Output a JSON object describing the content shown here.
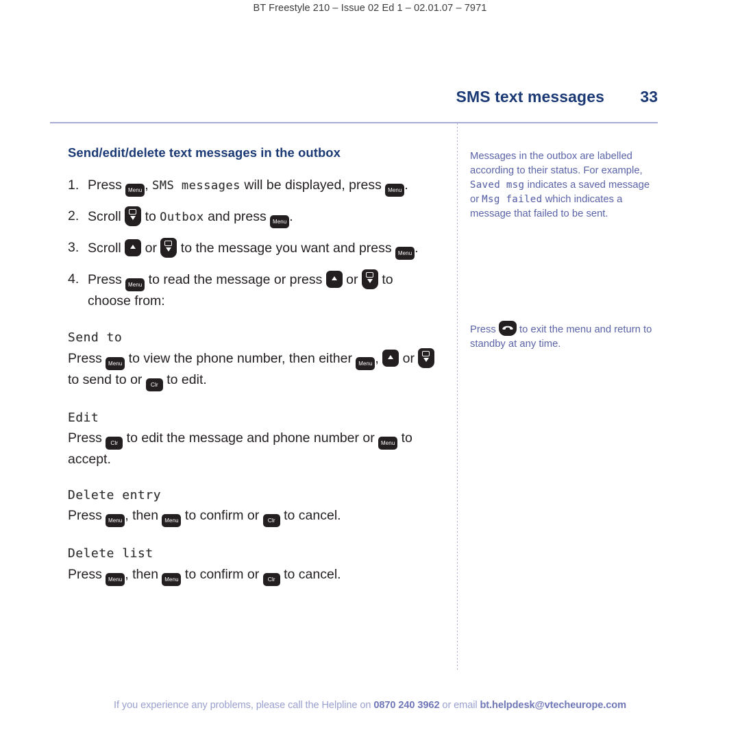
{
  "running_head": "BT Freestyle 210 – Issue 02 Ed 1 – 02.01.07 – 7971",
  "header": {
    "title": "SMS text messages",
    "page_number": "33"
  },
  "main": {
    "section_heading": "Send/edit/delete text messages in the outbox",
    "steps": [
      {
        "num": "1.",
        "t1": "Press ",
        "key1": "Menu",
        "t2": ", ",
        "lcd1": "SMS messages",
        "t3": " will be displayed, press ",
        "key2": "Menu",
        "t4": "."
      },
      {
        "num": "2.",
        "t1": "Scroll ",
        "key1": "down",
        "t2": " to ",
        "lcd1": "Outbox",
        "t3": " and press ",
        "key2": "Menu",
        "t4": "."
      },
      {
        "num": "3.",
        "t1": "Scroll ",
        "key1": "up",
        "t2": " or ",
        "key2": "down",
        "t3": " to the message you want and press ",
        "key3": "Menu",
        "t4": "."
      },
      {
        "num": "4.",
        "t1": "Press ",
        "key1": "Menu",
        "t2": " to read the message or press ",
        "key2": "up",
        "t3": " or ",
        "key3": "down",
        "t4": " to choose from:"
      }
    ],
    "subsections": [
      {
        "heading": "Send to",
        "b1": "Press ",
        "key1": "Menu",
        "b2": " to view the phone number, then either ",
        "key2": "Menu",
        "b3": ", ",
        "key3": "up",
        "b4": " or ",
        "key4": "down",
        "b5": " to send to or ",
        "key5": "Clr",
        "b6": " to edit."
      },
      {
        "heading": "Edit",
        "b1": "Press ",
        "key1": "Clr",
        "b2": " to edit the message and phone number or ",
        "key2": "Menu",
        "b3": " to accept."
      },
      {
        "heading": "Delete entry",
        "b1": "Press ",
        "key1": "Menu",
        "b2": ", then ",
        "key2": "Menu",
        "b3": " to confirm or ",
        "key3": "Clr",
        "b4": " to cancel."
      },
      {
        "heading": "Delete list",
        "b1": "Press ",
        "key1": "Menu",
        "b2": ", then ",
        "key2": "Menu",
        "b3": " to confirm or ",
        "key3": "Clr",
        "b4": " to cancel."
      }
    ]
  },
  "sidebar": {
    "note1_part1": "Messages in the outbox are labelled according to their status. For example, ",
    "note1_lcd1": "Saved msg",
    "note1_part2": " indicates a saved message or ",
    "note1_lcd2": "Msg failed",
    "note1_part3": " which indicates a message that failed to be sent.",
    "note2_part1": "Press ",
    "note2_key": "end-call",
    "note2_part2": " to exit the menu and return to standby at any time."
  },
  "footer": {
    "part1": "If you experience any problems, please call the Helpline on ",
    "phone": "0870 240 3962",
    "part2": " or email ",
    "email": "bt.helpdesk@vtecheurope.com"
  },
  "colors": {
    "heading_blue": "#1b3a75",
    "rule_lavender": "#a7abd3",
    "sidebar_blue": "#5a63a8",
    "footer_blue": "#9aa0cf",
    "key_black": "#231f20"
  }
}
